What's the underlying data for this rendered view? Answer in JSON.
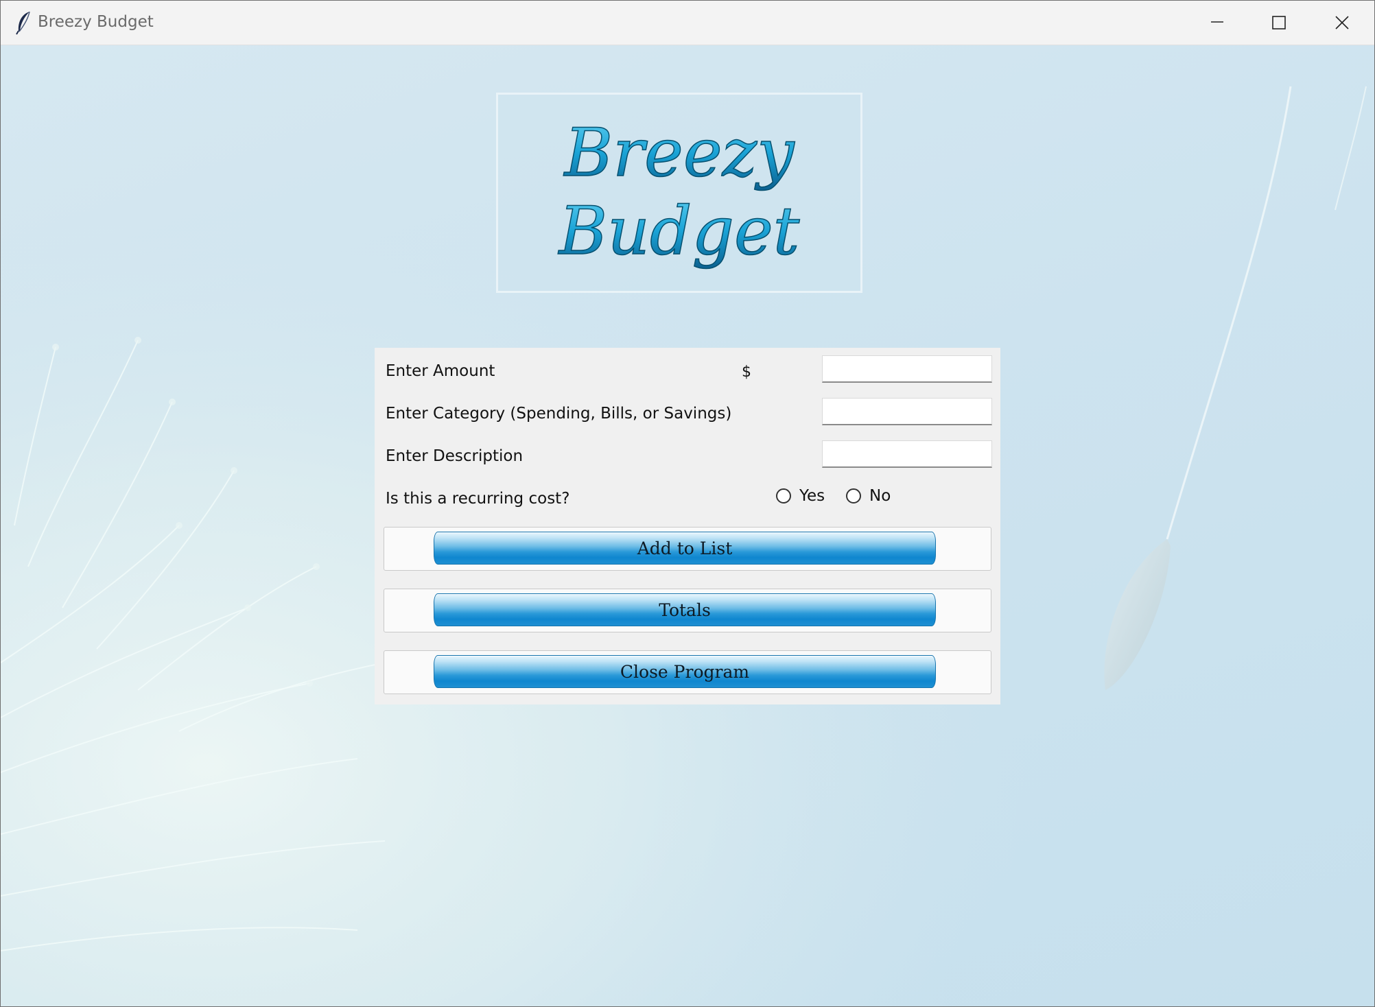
{
  "window": {
    "title": "Breezy Budget",
    "icon": "feather-icon",
    "controls": [
      "minimize-icon",
      "maximize-icon",
      "close-icon"
    ]
  },
  "logo": {
    "line1": "Breezy",
    "line2": "Budget"
  },
  "form": {
    "amount_label": "Enter Amount",
    "currency_symbol": "$",
    "amount_value": "",
    "category_label": "Enter Category (Spending, Bills, or Savings)",
    "category_value": "",
    "description_label": "Enter Description",
    "description_value": "",
    "recurring_label": "Is this a recurring cost?",
    "recurring_options": [
      {
        "label": "Yes",
        "selected": false
      },
      {
        "label": "No",
        "selected": false
      }
    ]
  },
  "buttons": {
    "add": "Add to List",
    "totals": "Totals",
    "close": "Close Program"
  },
  "colors": {
    "background": "#cfe4ef",
    "logo_text": "#1aa3d6",
    "button_accent": "#0f86cf"
  }
}
